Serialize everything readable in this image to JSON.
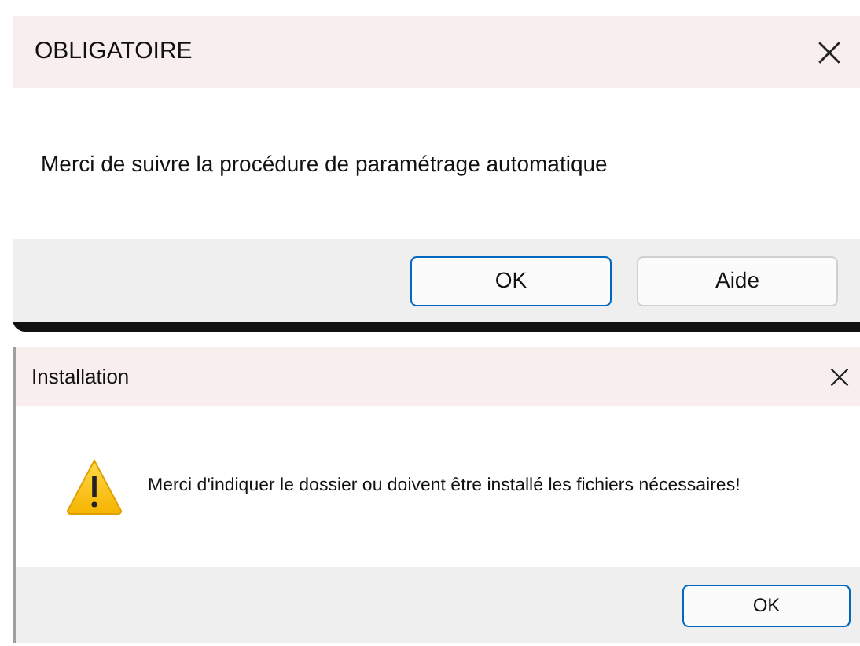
{
  "dialogs": [
    {
      "kind": "plain",
      "title": "OBLIGATOIRE",
      "message": "Merci de suivre la procédure de paramétrage automatique",
      "buttons": [
        {
          "label": "OK",
          "selected": true
        },
        {
          "label": "Aide",
          "selected": false
        }
      ]
    },
    {
      "kind": "warning",
      "title": "Installation",
      "message": "Merci d'indiquer le dossier ou doivent être installé les fichiers nécessaires!",
      "buttons": [
        {
          "label": "OK",
          "selected": true
        }
      ]
    }
  ]
}
